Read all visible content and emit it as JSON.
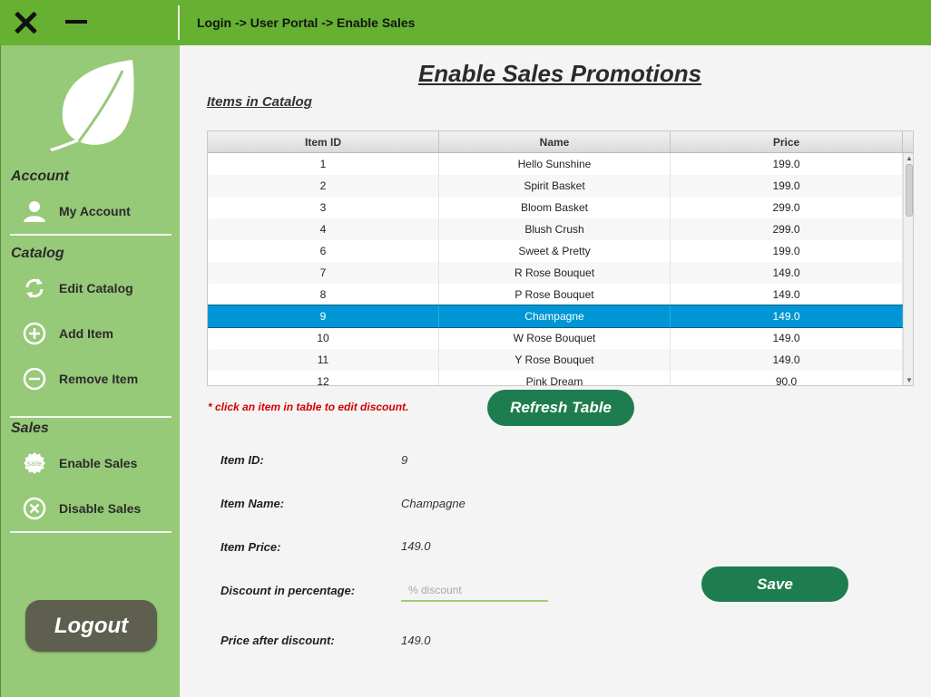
{
  "window": {
    "breadcrumb": "Login -> User Portal -> Enable Sales"
  },
  "sidebar": {
    "sections": {
      "account": "Account",
      "catalog": "Catalog",
      "sales": "Sales"
    },
    "items": {
      "my_account": "My Account",
      "edit_catalog": "Edit Catalog",
      "add_item": "Add Item",
      "remove_item": "Remove Item",
      "enable_sales": "Enable Sales",
      "disable_sales": "Disable Sales"
    },
    "sale_badge_text": "sale",
    "logout": "Logout"
  },
  "main": {
    "title": "Enable Sales Promotions",
    "catalog_heading": "Items in Catalog",
    "table": {
      "columns": [
        "Item ID",
        "Name",
        "Price"
      ],
      "rows": [
        [
          "1",
          "Hello Sunshine",
          "199.0"
        ],
        [
          "2",
          "Spirit Basket",
          "199.0"
        ],
        [
          "3",
          "Bloom Basket",
          "299.0"
        ],
        [
          "4",
          "Blush Crush",
          "299.0"
        ],
        [
          "6",
          "Sweet & Pretty",
          "199.0"
        ],
        [
          "7",
          "R Rose Bouquet",
          "149.0"
        ],
        [
          "8",
          "P Rose Bouquet",
          "149.0"
        ],
        [
          "9",
          "Champagne",
          "149.0"
        ],
        [
          "10",
          "W Rose Bouquet",
          "149.0"
        ],
        [
          "11",
          "Y Rose Bouquet",
          "149.0"
        ],
        [
          "12",
          "Pink Dream",
          "90.0"
        ]
      ],
      "selected_row_index": 7
    },
    "hint": "* click an item in table to edit discount.",
    "refresh_button": "Refresh Table",
    "details": {
      "item_id_label": "Item ID:",
      "item_id_value": "9",
      "item_name_label": "Item Name:",
      "item_name_value": "Champagne",
      "item_price_label": "Item Price:",
      "item_price_value": "149.0",
      "discount_label": "Discount in percentage:",
      "discount_value": "",
      "discount_placeholder": "% discount",
      "price_after_label": "Price after discount:",
      "price_after_value": "149.0"
    },
    "save_button": "Save"
  },
  "colors": {
    "topbar": "#66b032",
    "sidebar": "#96c978",
    "primary_button": "#1e7d4e",
    "logout_button": "#5e5f4f",
    "selected_row": "#0096d6",
    "hint_text": "#d40000"
  }
}
